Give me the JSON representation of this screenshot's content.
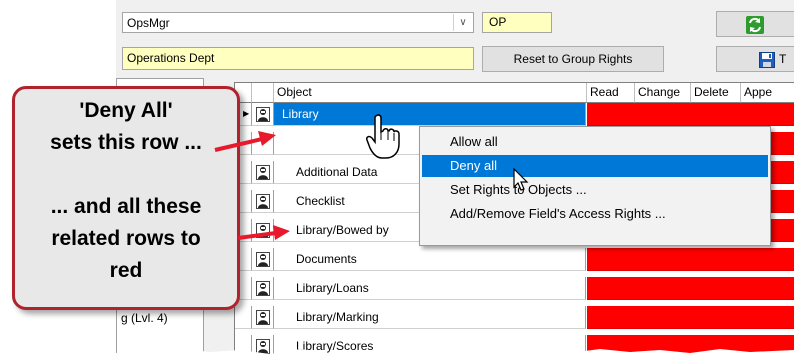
{
  "header": {
    "group_value": "OpsMgr",
    "group_code": "OP",
    "department": "Operations Dept",
    "reset_button": "Reset to Group Rights",
    "refresh_icon": "refresh-icon",
    "save_icon": "floppy-save-icon",
    "save_label_partial": "T"
  },
  "left_panel": {
    "level_text": "g (Lvl. 4)"
  },
  "grid": {
    "columns": [
      "Object",
      "Read",
      "Change",
      "Delete",
      "Appe"
    ],
    "rows": [
      {
        "name": "Library",
        "selected": true
      },
      {
        "name": "",
        "selected": false
      },
      {
        "name": "Additional Data",
        "selected": false
      },
      {
        "name": "Checklist",
        "selected": false
      },
      {
        "name": "Library/Bowed by",
        "selected": false
      },
      {
        "name": "Documents",
        "selected": false
      },
      {
        "name": "Library/Loans",
        "selected": false
      },
      {
        "name": "Library/Marking",
        "selected": false
      },
      {
        "name": "Library/Scores",
        "selected": false
      }
    ],
    "deny_color": "#ff0000",
    "row_icon": "user-icon"
  },
  "context_menu": {
    "items": [
      "Allow all",
      "Deny all",
      "Set Rights to Objects ...",
      "Add/Remove Field's Access Rights ..."
    ],
    "highlighted_index": 1
  },
  "callout": {
    "lines": [
      "'Deny All'",
      "sets this row ...",
      "",
      "... and all these",
      "related rows to",
      "red"
    ],
    "border_color": "#b0232d",
    "arrow_color": "#e8192c"
  }
}
